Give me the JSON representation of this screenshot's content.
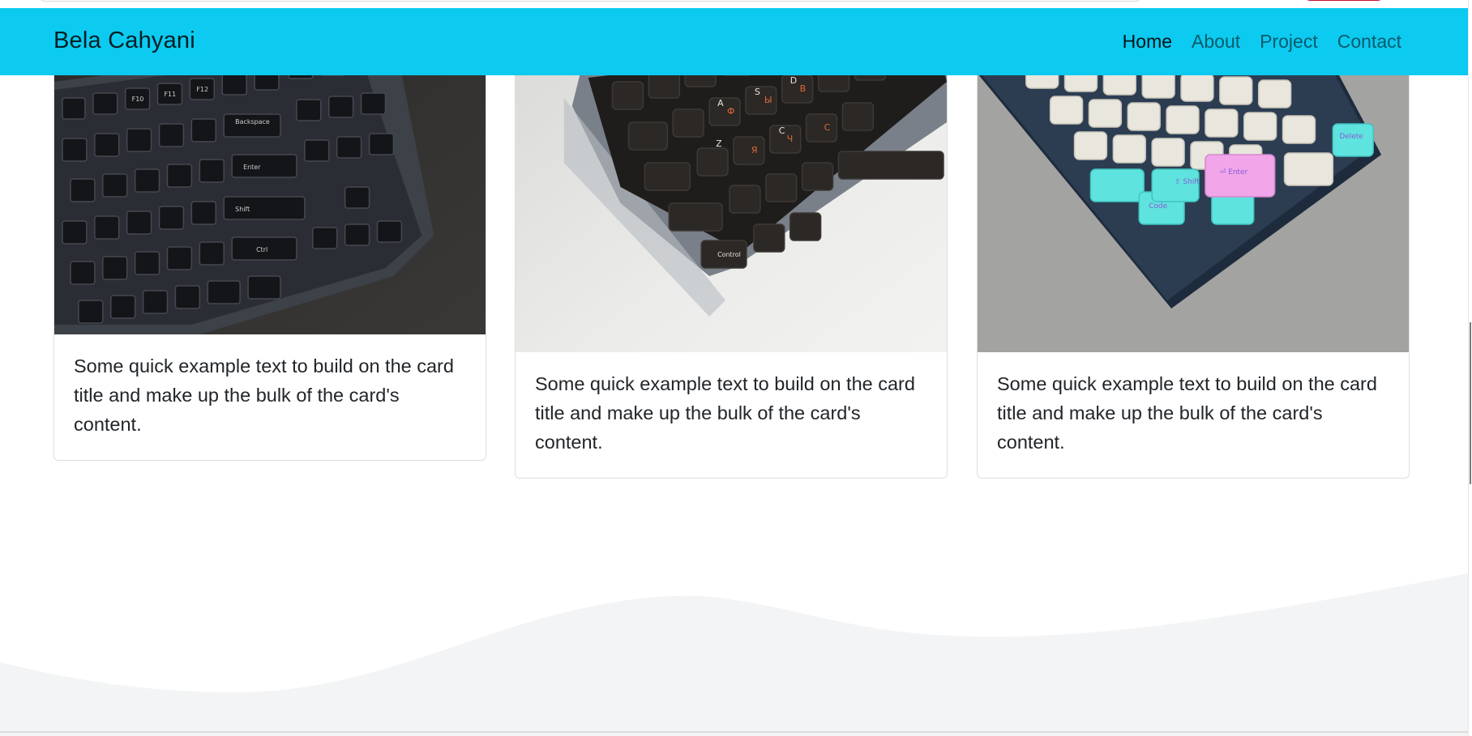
{
  "navbar": {
    "brand": "Bela Cahyani",
    "links": [
      "Home",
      "About",
      "Project",
      "Contact"
    ],
    "active": "Home",
    "background": "#0dcaf0"
  },
  "cards": [
    {
      "image_icon": "keyboard-dark-photo-icon",
      "text": "Some quick example text to build on the card title and make up the bulk of the card's content."
    },
    {
      "image_icon": "keyboard-black-orange-legends-photo-icon",
      "text": "Some quick example text to build on the card title and make up the bulk of the card's content."
    },
    {
      "image_icon": "keyboard-white-cyan-pink-photo-icon",
      "text": "Some quick example text to build on the card title and make up the bulk of the card's content."
    }
  ],
  "colors": {
    "wave": "#f3f4f5",
    "card_border": "#dee2e6",
    "keycap_cyan": "#5fe3de",
    "keycap_pink": "#f0a6e8"
  }
}
